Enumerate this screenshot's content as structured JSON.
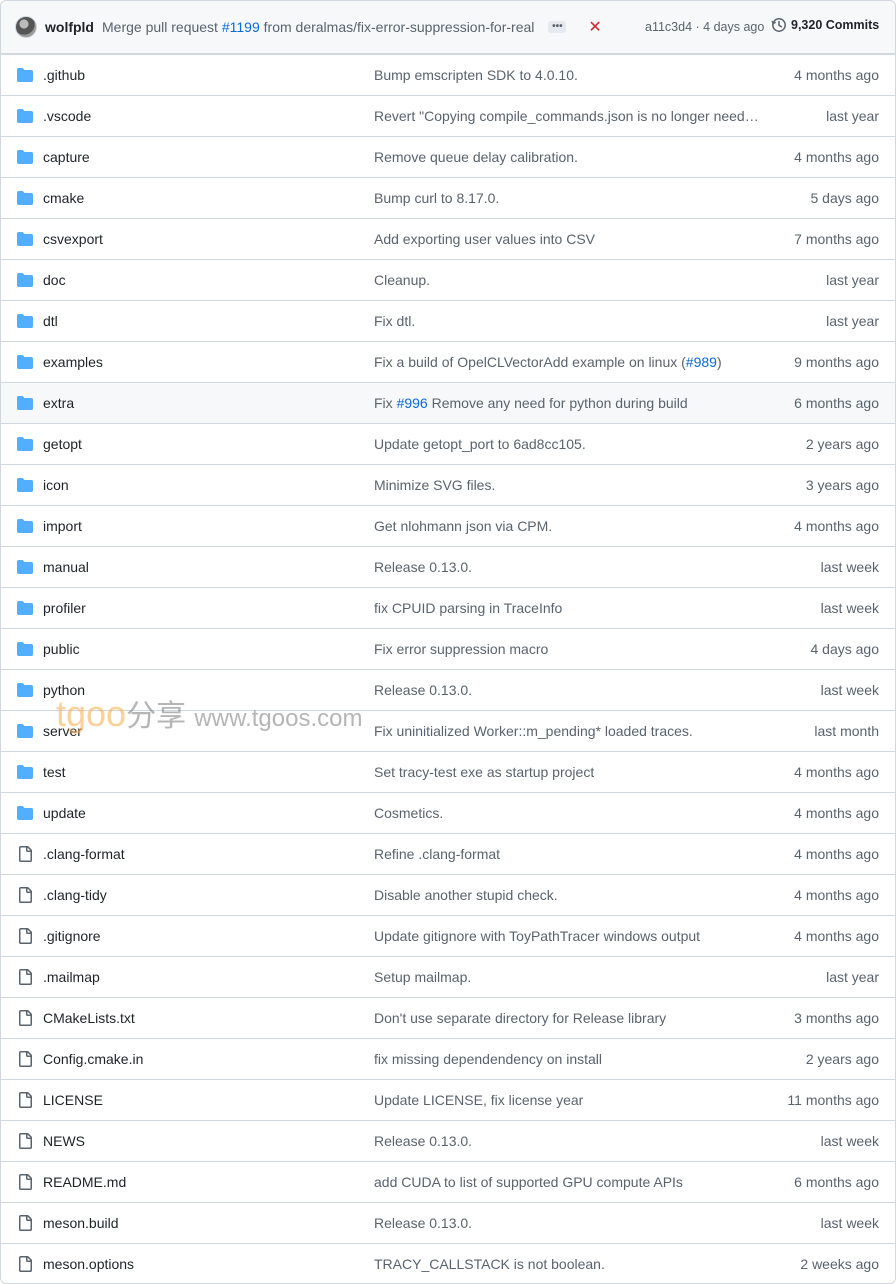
{
  "header": {
    "author": "wolfpld",
    "message_prefix": "Merge pull request ",
    "message_link": "#1199",
    "message_suffix": " from deralmas/fix-error-suppression-for-real",
    "ellipsis": "•••",
    "status": "✕",
    "sha": "a11c3d4 · 4 days ago",
    "commits": "9,320 Commits"
  },
  "rows": [
    {
      "type": "folder",
      "name": ".github",
      "msg": "Bump emscripten SDK to 4.0.10.",
      "age": "4 months ago"
    },
    {
      "type": "folder",
      "name": ".vscode",
      "msg": "Revert \"Copying compile_commands.json is no longer neede...",
      "age": "last year"
    },
    {
      "type": "folder",
      "name": "capture",
      "msg": "Remove queue delay calibration.",
      "age": "4 months ago"
    },
    {
      "type": "folder",
      "name": "cmake",
      "msg": "Bump curl to 8.17.0.",
      "age": "5 days ago"
    },
    {
      "type": "folder",
      "name": "csvexport",
      "msg": "Add exporting user values into CSV",
      "age": "7 months ago"
    },
    {
      "type": "folder",
      "name": "doc",
      "msg": "Cleanup.",
      "age": "last year"
    },
    {
      "type": "folder",
      "name": "dtl",
      "msg": "Fix dtl.",
      "age": "last year"
    },
    {
      "type": "folder",
      "name": "examples",
      "msg": "Fix a build of OpelCLVectorAdd example on linux (",
      "msg_link": "#989",
      "msg_after": ")",
      "age": "9 months ago"
    },
    {
      "type": "folder",
      "name": "extra",
      "msg": "Fix ",
      "msg_link": "#996",
      "msg_after": " Remove any need for python during build",
      "age": "6 months ago"
    },
    {
      "type": "folder",
      "name": "getopt",
      "msg": "Update getopt_port to 6ad8cc105.",
      "age": "2 years ago"
    },
    {
      "type": "folder",
      "name": "icon",
      "msg": "Minimize SVG files.",
      "age": "3 years ago"
    },
    {
      "type": "folder",
      "name": "import",
      "msg": "Get nlohmann json via CPM.",
      "age": "4 months ago"
    },
    {
      "type": "folder",
      "name": "manual",
      "msg": "Release 0.13.0.",
      "age": "last week"
    },
    {
      "type": "folder",
      "name": "profiler",
      "msg": "fix CPUID parsing in TraceInfo",
      "age": "last week"
    },
    {
      "type": "folder",
      "name": "public",
      "msg": "Fix error suppression macro",
      "age": "4 days ago"
    },
    {
      "type": "folder",
      "name": "python",
      "msg": "Release 0.13.0.",
      "age": "last week"
    },
    {
      "type": "folder",
      "name": "server",
      "msg": "Fix uninitialized Worker::m_pending* loaded traces.",
      "age": "last month"
    },
    {
      "type": "folder",
      "name": "test",
      "msg": "Set tracy-test exe as startup project",
      "age": "4 months ago"
    },
    {
      "type": "folder",
      "name": "update",
      "msg": "Cosmetics.",
      "age": "4 months ago"
    },
    {
      "type": "file",
      "name": ".clang-format",
      "msg": "Refine .clang-format",
      "age": "4 months ago"
    },
    {
      "type": "file",
      "name": ".clang-tidy",
      "msg": "Disable another stupid check.",
      "age": "4 months ago"
    },
    {
      "type": "file",
      "name": ".gitignore",
      "msg": "Update gitignore with ToyPathTracer windows output",
      "age": "4 months ago"
    },
    {
      "type": "file",
      "name": ".mailmap",
      "msg": "Setup mailmap.",
      "age": "last year"
    },
    {
      "type": "file",
      "name": "CMakeLists.txt",
      "msg": "Don't use separate directory for Release library",
      "age": "3 months ago"
    },
    {
      "type": "file",
      "name": "Config.cmake.in",
      "msg": "fix missing dependendency on install",
      "age": "2 years ago"
    },
    {
      "type": "file",
      "name": "LICENSE",
      "msg": "Update LICENSE, fix license year",
      "age": "11 months ago"
    },
    {
      "type": "file",
      "name": "NEWS",
      "msg": "Release 0.13.0.",
      "age": "last week"
    },
    {
      "type": "file",
      "name": "README.md",
      "msg": "add CUDA to list of supported GPU compute APIs",
      "age": "6 months ago"
    },
    {
      "type": "file",
      "name": "meson.build",
      "msg": "Release 0.13.0.",
      "age": "last week"
    },
    {
      "type": "file",
      "name": "meson.options",
      "msg": "TRACY_CALLSTACK is not boolean.",
      "age": "2 weeks ago"
    }
  ],
  "watermark": {
    "brand": "tgoo",
    "cn": "分享",
    "url": "www.tgoos.com"
  },
  "colors": {
    "folder": "#54aeff",
    "file": "#59636e",
    "link": "#0969da",
    "fail": "#d1242f"
  }
}
